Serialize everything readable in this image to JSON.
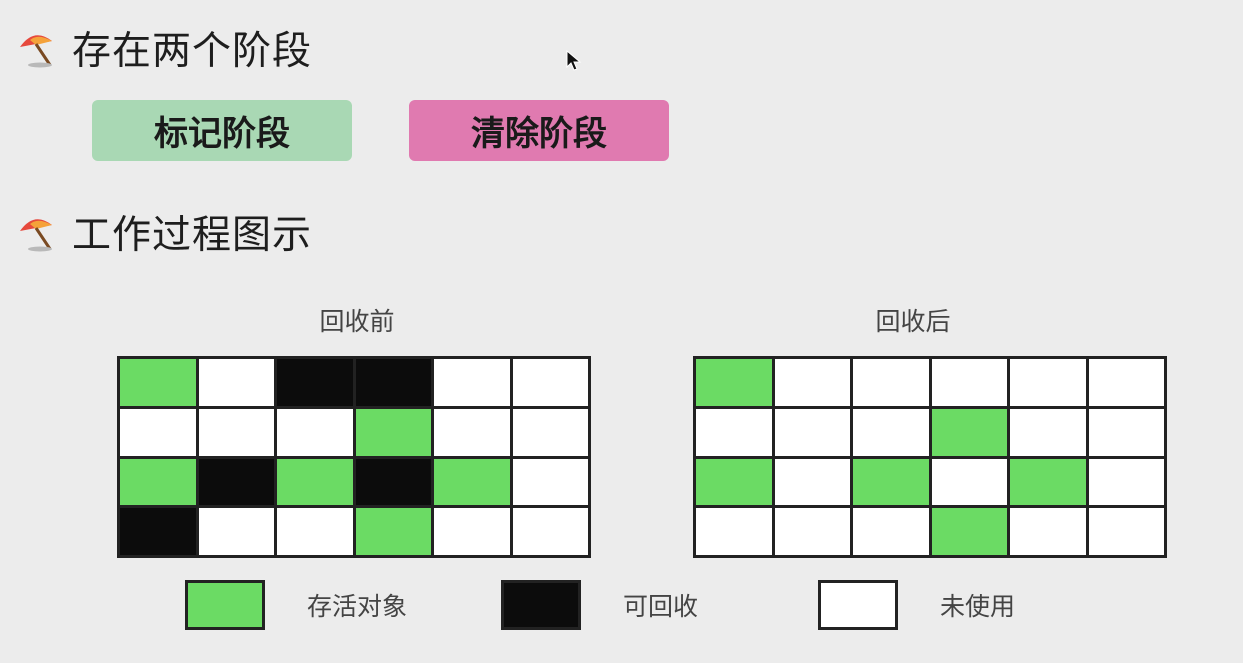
{
  "headings": {
    "two_phases": "存在两个阶段",
    "process_diagram": "工作过程图示"
  },
  "phases": {
    "mark": "标记阶段",
    "sweep": "清除阶段"
  },
  "grids": {
    "before_title": "回收前",
    "after_title": "回收后",
    "before": [
      [
        "live",
        "free",
        "garbage",
        "garbage",
        "free",
        "free"
      ],
      [
        "free",
        "free",
        "free",
        "live",
        "free",
        "free"
      ],
      [
        "live",
        "garbage",
        "live",
        "garbage",
        "live",
        "free"
      ],
      [
        "garbage",
        "free",
        "free",
        "live",
        "free",
        "free"
      ]
    ],
    "after": [
      [
        "live",
        "free",
        "free",
        "free",
        "free",
        "free"
      ],
      [
        "free",
        "free",
        "free",
        "live",
        "free",
        "free"
      ],
      [
        "live",
        "free",
        "live",
        "free",
        "live",
        "free"
      ],
      [
        "free",
        "free",
        "free",
        "live",
        "free",
        "free"
      ]
    ]
  },
  "legend": {
    "live": "存活对象",
    "garbage": "可回收",
    "free": "未使用"
  },
  "colors": {
    "live": "#6bdb64",
    "garbage": "#0c0c0c",
    "free": "#ffffff",
    "mark_phase": "#a9d8b4",
    "sweep_phase": "#e07ab0"
  },
  "icons": {
    "bullet": "umbrella-icon",
    "cursor": "mouse-cursor-icon"
  }
}
